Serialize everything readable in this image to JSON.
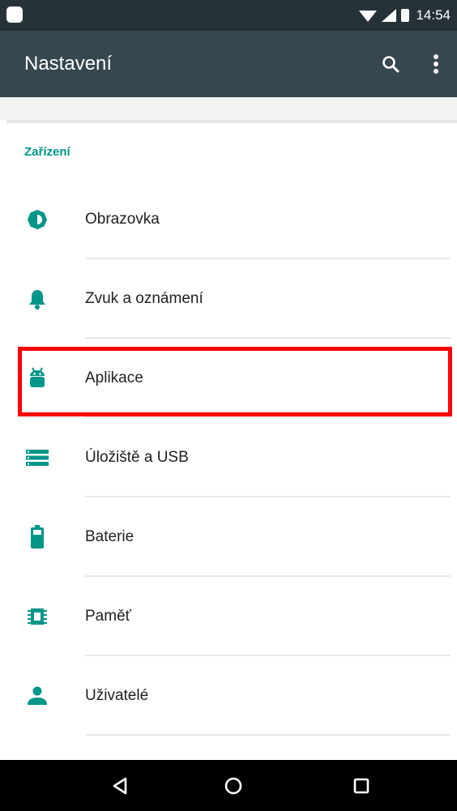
{
  "status_bar": {
    "time": "14:54",
    "icons": [
      "notification-icon",
      "wifi-icon",
      "signal-icon",
      "battery-icon"
    ]
  },
  "app_bar": {
    "title": "Nastavení",
    "actions": [
      "search-icon",
      "more-vert-icon"
    ]
  },
  "settings": {
    "category": "Zařízení",
    "items": [
      {
        "label": "Obrazovka",
        "icon": "brightness-icon"
      },
      {
        "label": "Zvuk a oznámení",
        "icon": "bell-icon"
      },
      {
        "label": "Aplikace",
        "icon": "android-icon"
      },
      {
        "label": "Úložiště a USB",
        "icon": "storage-icon"
      },
      {
        "label": "Baterie",
        "icon": "battery-icon"
      },
      {
        "label": "Paměť",
        "icon": "memory-icon"
      },
      {
        "label": "Uživatelé",
        "icon": "person-icon"
      }
    ]
  },
  "nav_bar": {
    "buttons": [
      "back-icon",
      "home-icon",
      "recents-icon"
    ]
  },
  "colors": {
    "status_bar": "#263238",
    "app_bar": "#37474F",
    "accent": "#009688",
    "highlight": "#FF0000"
  }
}
